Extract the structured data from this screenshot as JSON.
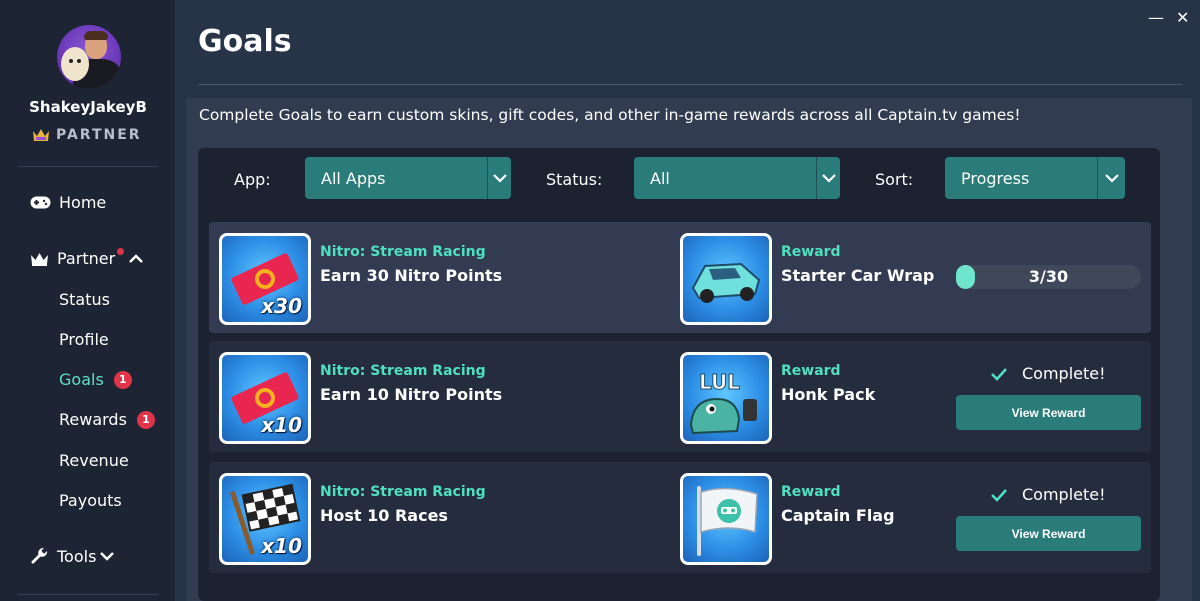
{
  "window": {
    "minimize_glyph": "—",
    "close_glyph": "✕"
  },
  "user": {
    "name": "ShakeyJakeyB",
    "badge": "PARTNER"
  },
  "nav": {
    "home": "Home",
    "partner": "Partner",
    "sub": [
      {
        "label": "Status"
      },
      {
        "label": "Profile"
      },
      {
        "label": "Goals",
        "badge": "1"
      },
      {
        "label": "Rewards",
        "badge": "1"
      },
      {
        "label": "Revenue"
      },
      {
        "label": "Payouts"
      }
    ],
    "tools": "Tools"
  },
  "page": {
    "title": "Goals",
    "intro": "Complete Goals to earn custom skins, gift codes, and other in-game rewards across all Captain.tv games!"
  },
  "filters": {
    "app_label": "App:",
    "app_value": "All Apps",
    "status_label": "Status:",
    "status_value": "All",
    "sort_label": "Sort:",
    "sort_value": "Progress"
  },
  "goals": [
    {
      "category": "Nitro: Stream Racing",
      "name": "Earn 30 Nitro Points",
      "goal_icon": "ticket-icon",
      "multiplier": "x30",
      "reward_category": "Reward",
      "reward_name": "Starter Car Wrap",
      "reward_icon": "car-icon",
      "progress_text": "3/30",
      "progress": 0.1
    },
    {
      "category": "Nitro: Stream Racing",
      "name": "Earn 10 Nitro Points",
      "goal_icon": "ticket-icon",
      "multiplier": "x10",
      "reward_category": "Reward",
      "reward_name": "Honk Pack",
      "reward_icon": "lul-honk-icon",
      "reward_icon_text": "LUL",
      "status_text": "Complete!",
      "button_label": "View Reward"
    },
    {
      "category": "Nitro: Stream Racing",
      "name": "Host 10 Races",
      "goal_icon": "checkered-flag-icon",
      "multiplier": "x10",
      "reward_category": "Reward",
      "reward_name": "Captain Flag",
      "reward_icon": "captain-flag-icon",
      "status_text": "Complete!",
      "button_label": "View Reward"
    }
  ],
  "colors": {
    "accent": "#2a7c7a",
    "highlight": "#4fe0be",
    "badge": "#e0344b"
  }
}
